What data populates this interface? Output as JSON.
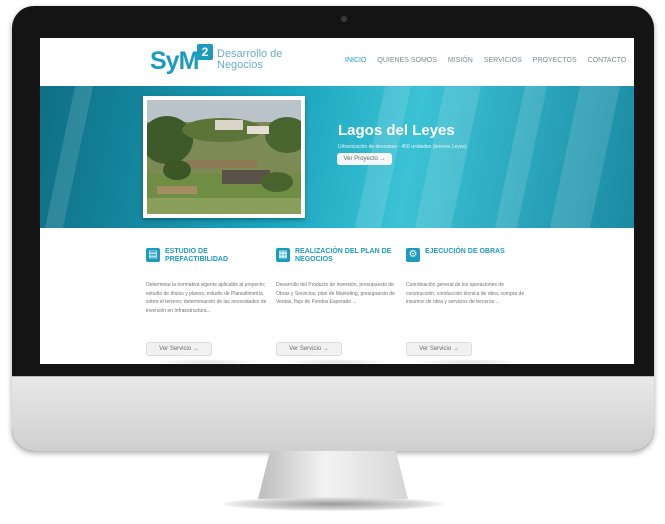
{
  "logo": {
    "mark": "SyM",
    "badge": "2",
    "subtitle": "Desarrollo de Negocios"
  },
  "nav": {
    "items": [
      "INICIO",
      "QUIENES SOMOS",
      "MISIÓN",
      "SERVICIOS",
      "PROYECTOS",
      "CONTACTO"
    ],
    "active": "INICIO"
  },
  "hero": {
    "title": "Lagos del Leyes",
    "subtitle": "Urbanización de descanso - 450 unidades (terreno Leyes)",
    "button": "Ver Proyecto  →"
  },
  "services": [
    {
      "title": "ESTUDIO DE PREFACTIBILIDAD",
      "icon": "document-icon",
      "text": "Determinar la normativa vigente aplicable al proyecto; estudio de títulos y planos, estudio de Planialtimetría sobre el terreno; determinación de las necesidades de inversión en Infraestructura...",
      "button": "Ver Servicio  →"
    },
    {
      "title": "REALIZACIÓN DEL PLAN DE NEGOCIOS",
      "icon": "chart-icon",
      "text": "Desarrollo del Producto de inversión, presupuesto de Obras y Servicios, plan de Marketing, presupuesto de Ventas, flujo de Fondos Esperado ...",
      "button": "Ver Servicio  →"
    },
    {
      "title": "EJECUCIÓN DE OBRAS",
      "icon": "gear-icon",
      "text": "Coordinación general de los operaciones de construcción, conducción técnica de obra, compra de insumos de obra y servicios de terceros ...",
      "button": "Ver Servicio  →"
    }
  ],
  "colors": {
    "brand": "#1d9bbf",
    "hero": "#1aa3bd",
    "bezel": "#141414"
  }
}
